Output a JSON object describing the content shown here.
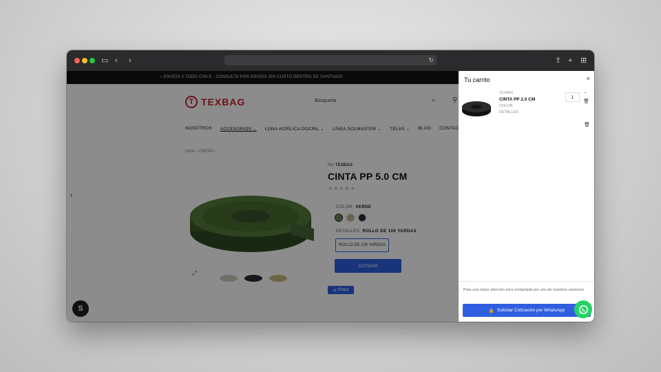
{
  "announcement": "⌂ ENVÍOS A TODO CHILE - CONSULTA POR ENVÍOS SIN COSTO DENTRO DE SANTIAGO",
  "header": {
    "logo_text": "TEXBAG",
    "search_label": "Búsqueda"
  },
  "nav": [
    {
      "label": "NOSOTROS"
    },
    {
      "label": "ACCESORIOS ⌄"
    },
    {
      "label": "LONA ACRÍLICA DOCRIL ⌄"
    },
    {
      "label": "LÍNEA SOLMASTER ⌄"
    },
    {
      "label": "TELAS ⌄"
    },
    {
      "label": "BLOG"
    },
    {
      "label": "CONTACTO"
    }
  ],
  "breadcrumb": "Inicio  ›  CINTAS  ›",
  "product": {
    "vendor_prefix": "Por",
    "vendor": "TEXBAG",
    "title": "CINTA PP 5.0 CM",
    "stars": "★★★★★",
    "color_label": "COLOR:",
    "color_value": "VERDE",
    "details_label": "DETALLES:",
    "details_value": "ROLLO DE 100 YARDAS",
    "variant": "ROLLO DE 100 YARDAS",
    "cotizar_label": "COTIZAR",
    "share_label": "Share",
    "colors": [
      "#6e7e5c",
      "#c2b98a",
      "#2a2a2a"
    ]
  },
  "cart": {
    "title": "Tu carrito",
    "item": {
      "vendor": "TEXBAG",
      "name": "CINTA PP 2.0 CM",
      "option1": "COLOR",
      "option2": "DETALLES",
      "qty": "1"
    },
    "footer_note": "Para una mejor atención será contactado por uno de nuestros asesores.",
    "whatsapp_button": "Solicitar Cotización por WhatsApp"
  },
  "icons": {
    "close": "×",
    "arrow_left": "‹",
    "trash": "🗑"
  }
}
